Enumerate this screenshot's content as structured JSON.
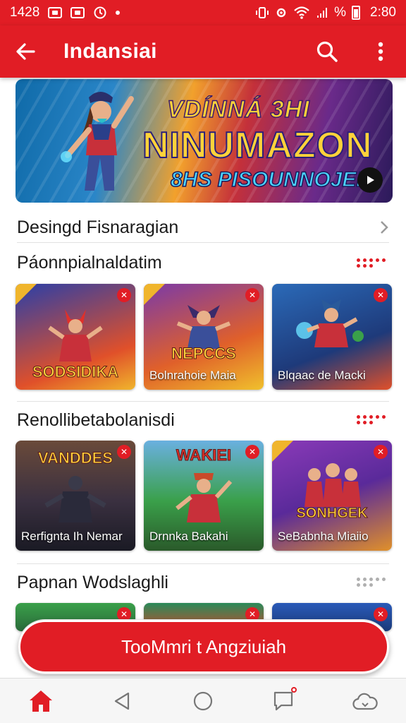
{
  "status_bar": {
    "time_left": "1428",
    "time_right": "2:80",
    "signal_text": "%"
  },
  "app_bar": {
    "title": "Indansiai",
    "back_icon": "arrow-left-icon",
    "search_icon": "search-icon",
    "menu_icon": "more-vert-icon"
  },
  "hero": {
    "line1": "VDÍNNÁ 3HI",
    "line2": "NINUMAZON",
    "line3": "8HS PISOUNNOJEI!",
    "play_icon": "play-icon"
  },
  "link_row": {
    "label": "Desingd Fisnaragian"
  },
  "sections": [
    {
      "title": "Páonnpialnaldatim",
      "dots_color": "#e11d25",
      "cards": [
        {
          "art_title": "SODSIDIKA",
          "caption": "",
          "bg": "#2a3fa8"
        },
        {
          "art_title": "NEPCCS",
          "caption": "Bolnrahoie Maia",
          "bg": "#7a3aa8"
        },
        {
          "art_title": "",
          "caption": "Blqaac de Macki",
          "bg": "#2b6ab8"
        }
      ]
    },
    {
      "title": "Renollibetabolanisdi",
      "dots_color": "#e11d25",
      "cards": [
        {
          "art_title": "VANDDES",
          "caption": "Rerfignta Ih Nemar",
          "bg": "#3a3040"
        },
        {
          "art_title": "WAKIEI",
          "caption": "Drnnka Bakahi",
          "bg": "#2f8a3a"
        },
        {
          "art_title": "SONHGEK",
          "caption": "SeBabnha Miaiio",
          "bg": "#8a3ab8"
        }
      ]
    },
    {
      "title": "Papnan Wodslaghli",
      "dots_color": "#b0b0b0",
      "cards": [
        {
          "art_title": "",
          "caption": "",
          "bg": "#3aa04a"
        },
        {
          "art_title": "",
          "caption": "",
          "bg": "#2a8a5a"
        },
        {
          "art_title": "",
          "caption": "",
          "bg": "#2a5ab8"
        }
      ]
    }
  ],
  "cta": {
    "label": "TooMmri t Angziuiah"
  },
  "bottom_nav": [
    {
      "icon": "home-icon",
      "active": true
    },
    {
      "icon": "back-triangle-icon",
      "active": false
    },
    {
      "icon": "home-circle-icon",
      "active": false
    },
    {
      "icon": "chat-icon",
      "active": false
    },
    {
      "icon": "cloud-icon",
      "active": false
    }
  ],
  "colors": {
    "primary": "#e11d25"
  }
}
